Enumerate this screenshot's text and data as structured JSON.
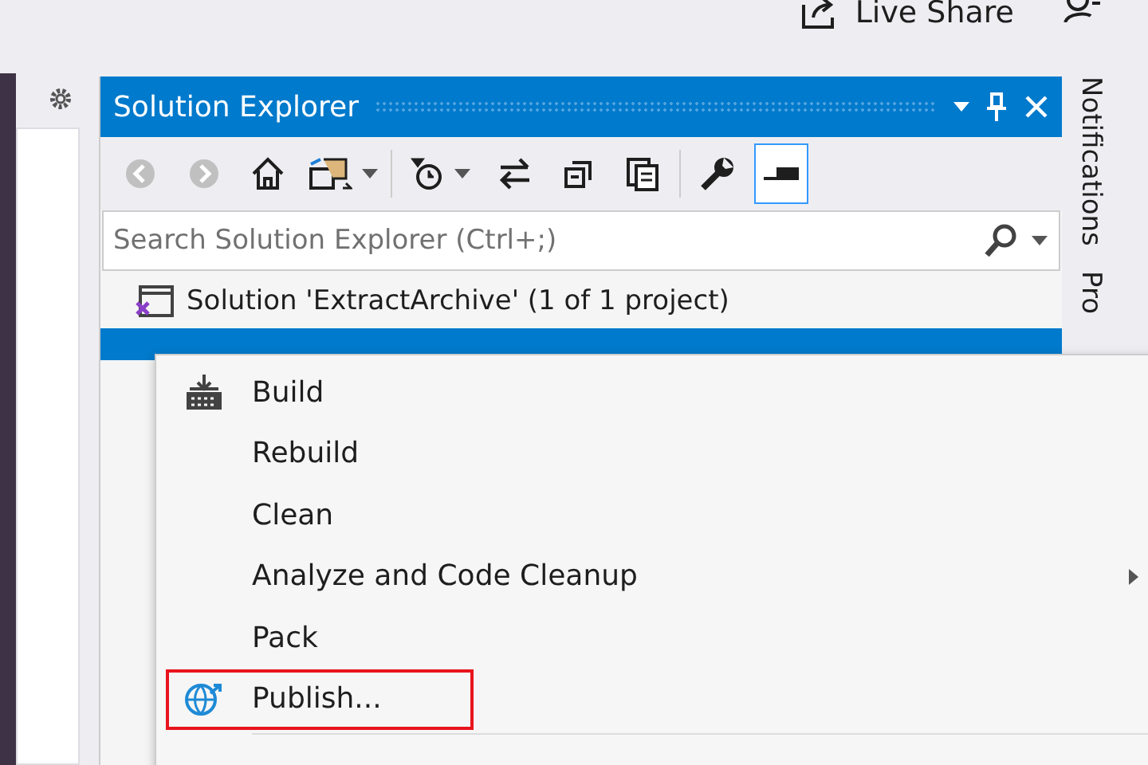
{
  "top_bar": {
    "live_share": "Live Share"
  },
  "solution_explorer": {
    "title": "Solution Explorer",
    "toolbar": [
      {
        "kind": "back",
        "disabled": true
      },
      {
        "kind": "forward",
        "disabled": true
      },
      {
        "kind": "home",
        "disabled": false
      },
      {
        "kind": "switch-views",
        "disabled": false
      },
      {
        "kind": "pending-changes",
        "disabled": false
      },
      {
        "kind": "sync",
        "disabled": false
      },
      {
        "kind": "collapse",
        "disabled": false
      },
      {
        "kind": "show-all",
        "disabled": false
      },
      {
        "kind": "properties",
        "disabled": false
      },
      {
        "kind": "preview",
        "disabled": false,
        "selected": true
      }
    ],
    "search": {
      "placeholder": "Search Solution Explorer (Ctrl+;)"
    },
    "tree": [
      {
        "label": "Solution 'ExtractArchive' (1 of 1 project)",
        "selected": false
      },
      {
        "selected": true
      }
    ]
  },
  "context_menu": {
    "items": [
      {
        "label": "Build",
        "kind": "build",
        "submenu": false,
        "highlighted": false
      },
      {
        "label": "Rebuild",
        "submenu": false,
        "highlighted": false
      },
      {
        "label": "Clean",
        "submenu": false,
        "highlighted": false
      },
      {
        "label": "Analyze and Code Cleanup",
        "submenu": true,
        "highlighted": false
      },
      {
        "label": "Pack",
        "submenu": false,
        "highlighted": false
      },
      {
        "label": "Publish...",
        "kind": "publish",
        "submenu": false,
        "highlighted": true
      }
    ]
  },
  "side_tabs": [
    "Notifications",
    "Pro"
  ]
}
